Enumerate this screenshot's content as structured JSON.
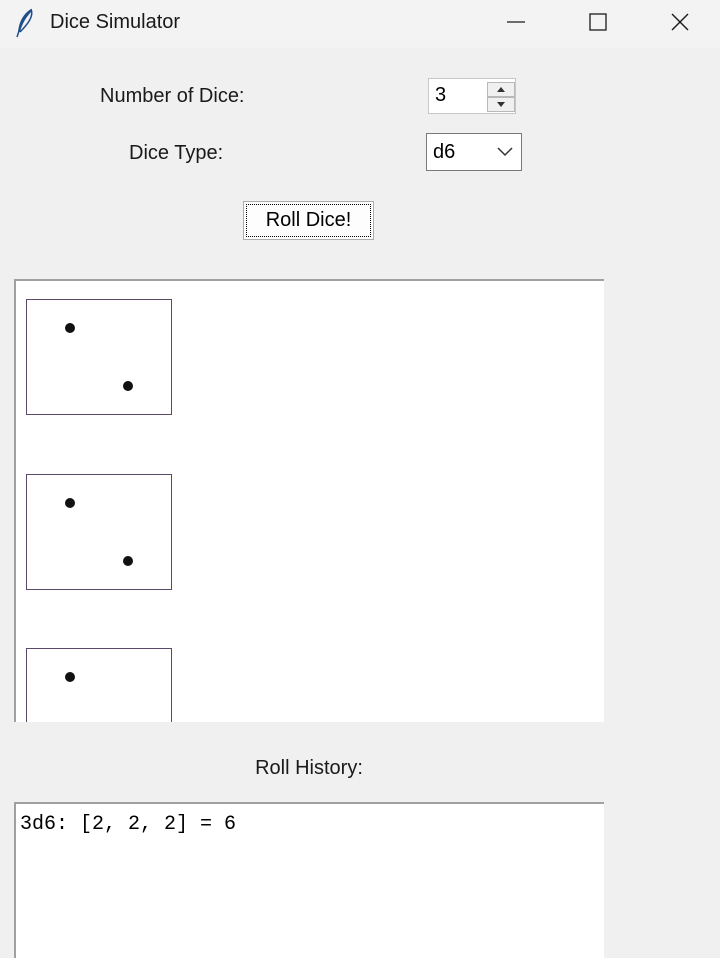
{
  "window": {
    "title": "Dice Simulator",
    "icon": "feather-icon",
    "controls": [
      "minimize-icon",
      "maximize-icon",
      "close-icon"
    ]
  },
  "form": {
    "num_dice_label": "Number of Dice:",
    "num_dice_value": "3",
    "dice_type_label": "Dice Type:",
    "dice_type_value": "d6",
    "roll_button_label": "Roll Dice!"
  },
  "dice": [
    {
      "value": 2
    },
    {
      "value": 2
    },
    {
      "value": 2
    }
  ],
  "history": {
    "label": "Roll History:",
    "entries": [
      "3d6: [2, 2, 2] = 6"
    ]
  }
}
